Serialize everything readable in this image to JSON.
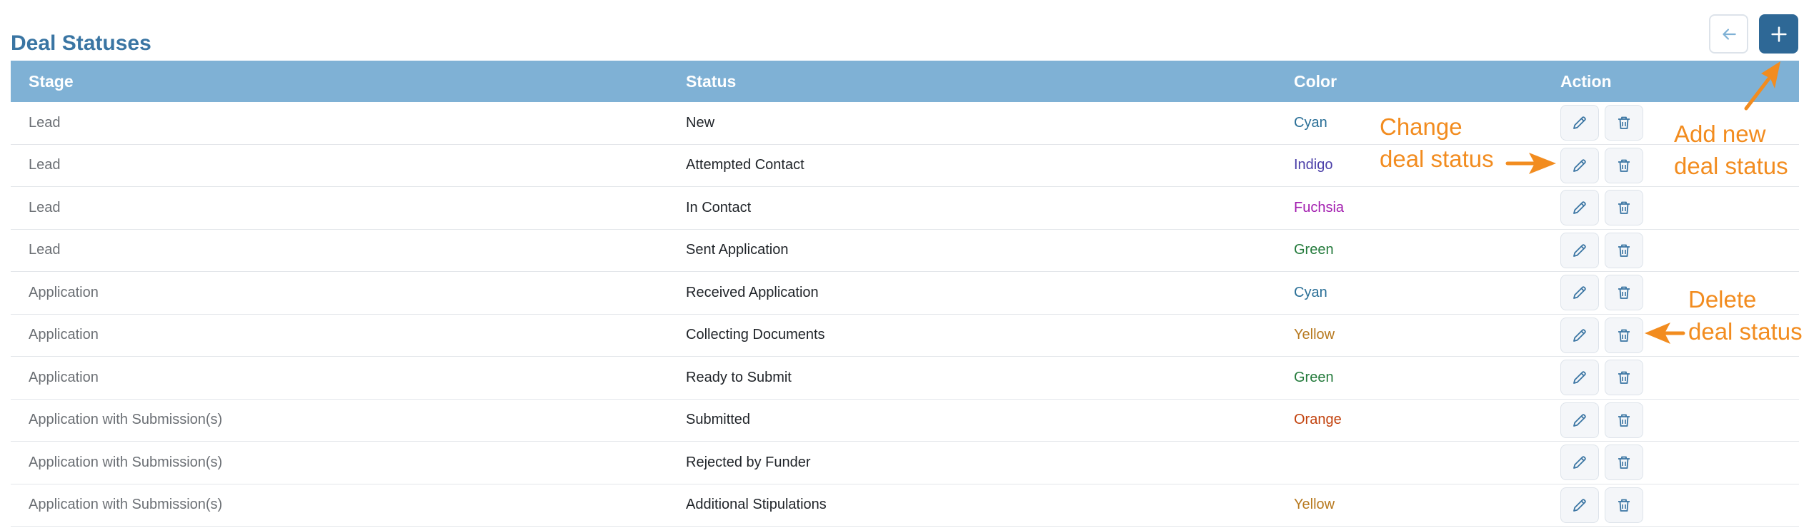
{
  "page": {
    "title": "Deal Statuses"
  },
  "toolbar": {
    "back_icon": "arrow-left-icon",
    "add_icon": "plus-icon"
  },
  "table": {
    "columns": {
      "stage": "Stage",
      "status": "Status",
      "color": "Color",
      "action": "Action"
    },
    "rows": [
      {
        "stage": "Lead",
        "status": "New",
        "color": "Cyan",
        "color_hex": "#2a6f97"
      },
      {
        "stage": "Lead",
        "status": "Attempted Contact",
        "color": "Indigo",
        "color_hex": "#4b3fa8"
      },
      {
        "stage": "Lead",
        "status": "In Contact",
        "color": "Fuchsia",
        "color_hex": "#a21caf"
      },
      {
        "stage": "Lead",
        "status": "Sent Application",
        "color": "Green",
        "color_hex": "#237a3b"
      },
      {
        "stage": "Application",
        "status": "Received Application",
        "color": "Cyan",
        "color_hex": "#2a6f97"
      },
      {
        "stage": "Application",
        "status": "Collecting Documents",
        "color": "Yellow",
        "color_hex": "#b7791f"
      },
      {
        "stage": "Application",
        "status": "Ready to Submit",
        "color": "Green",
        "color_hex": "#237a3b"
      },
      {
        "stage": "Application with Submission(s)",
        "status": "Submitted",
        "color": "Orange",
        "color_hex": "#c2410c"
      },
      {
        "stage": "Application with Submission(s)",
        "status": "Rejected by Funder",
        "color": "",
        "color_hex": "#1f2328"
      },
      {
        "stage": "Application with Submission(s)",
        "status": "Additional Stipulations",
        "color": "Yellow",
        "color_hex": "#b7791f"
      }
    ],
    "row_action_icons": {
      "edit": "pencil-icon",
      "delete": "trash-icon"
    }
  },
  "annotations": {
    "change": {
      "line1": "Change",
      "line2": "deal status"
    },
    "add": {
      "line1": "Add new",
      "line2": "deal status"
    },
    "delete": {
      "line1": "Delete",
      "line2": "deal status"
    },
    "color": "#f28c1f"
  }
}
